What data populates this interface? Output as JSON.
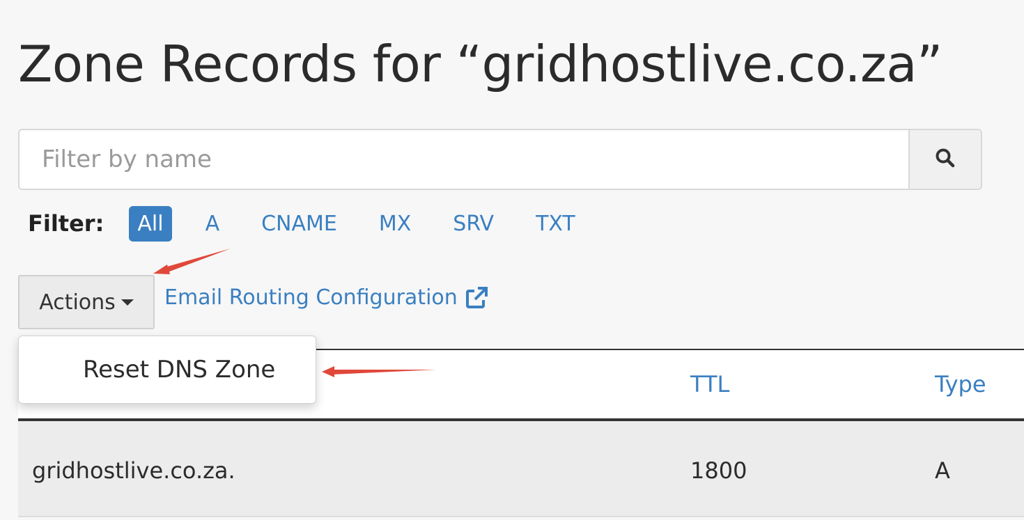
{
  "page": {
    "title": "Zone Records for “gridhostlive.co.za”"
  },
  "search": {
    "placeholder": "Filter by name",
    "value": "",
    "button_icon": "search-icon"
  },
  "filter": {
    "label": "Filter:",
    "options": [
      {
        "label": "All",
        "active": true
      },
      {
        "label": "A",
        "active": false
      },
      {
        "label": "CNAME",
        "active": false
      },
      {
        "label": "MX",
        "active": false
      },
      {
        "label": "SRV",
        "active": false
      },
      {
        "label": "TXT",
        "active": false
      }
    ]
  },
  "toolbar": {
    "actions_label": "Actions",
    "email_routing_label": "Email Routing Configuration",
    "external_link_icon": "external-link-icon"
  },
  "actions_menu": {
    "items": [
      {
        "label": "Reset DNS Zone"
      }
    ]
  },
  "table": {
    "columns": [
      "TTL",
      "Type"
    ],
    "rows": [
      {
        "name": "gridhostlive.co.za.",
        "ttl": "1800",
        "type": "A"
      }
    ]
  },
  "colors": {
    "link_blue": "#3a7fc1",
    "annotation_red": "#e0483a",
    "page_background": "#f7f7f7"
  }
}
